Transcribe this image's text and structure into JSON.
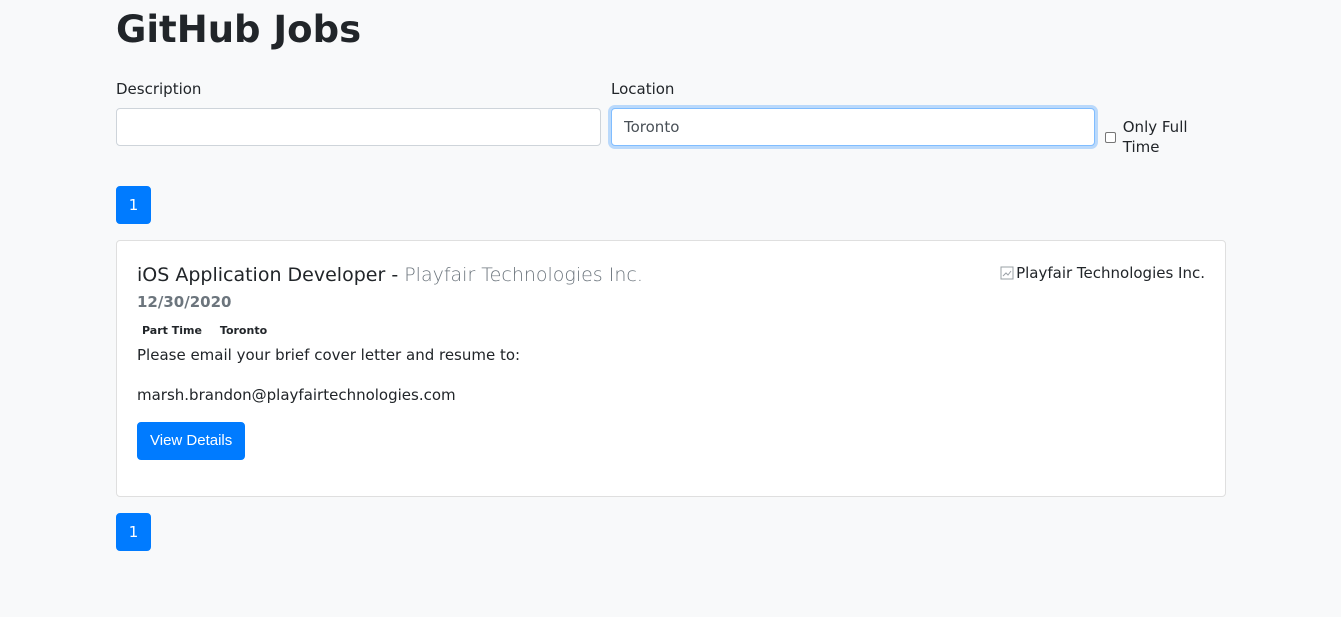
{
  "header": {
    "title": "GitHub Jobs"
  },
  "search": {
    "description_label": "Description",
    "description_value": "",
    "location_label": "Location",
    "location_value": "Toronto",
    "full_time_label": "Only Full Time",
    "full_time_checked": false
  },
  "pagination": {
    "top_page": "1",
    "bottom_page": "1"
  },
  "jobs": [
    {
      "title": "iOS Application Developer",
      "separator": "-",
      "company": "Playfair Technologies Inc.",
      "date": "12/30/2020",
      "type": "Part Time",
      "location": "Toronto",
      "description_lines": [
        "Please email your brief cover letter and resume to:",
        "marsh.brandon@playfairtechnologies.com"
      ],
      "logo_alt": "Playfair Technologies Inc.",
      "details_label": "View Details"
    }
  ],
  "colors": {
    "primary": "#007bff",
    "background": "#f8f9fa",
    "muted": "#6c757d"
  }
}
